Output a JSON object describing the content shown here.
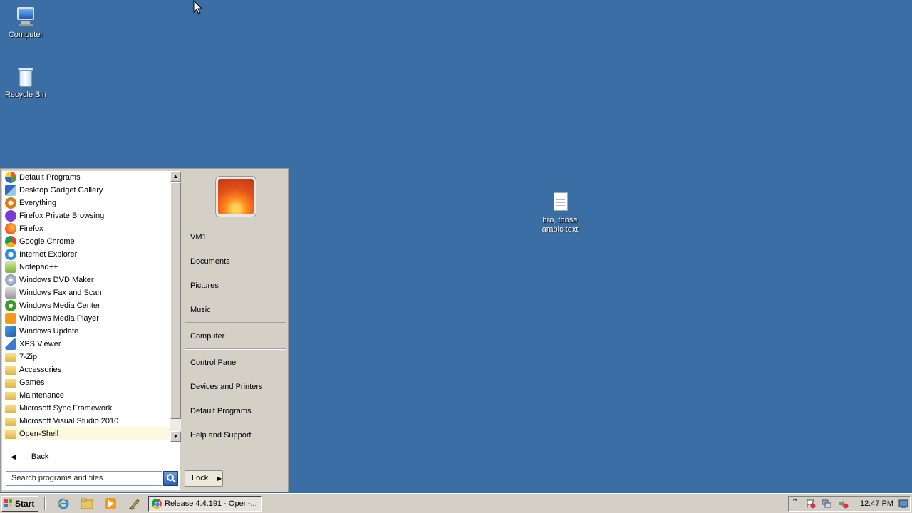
{
  "desktop": {
    "icons": [
      {
        "label": "Computer",
        "icon": "computer-icon"
      },
      {
        "label": "Recycle Bin",
        "icon": "recycle-bin-icon"
      },
      {
        "label_line1": "bro, those",
        "label_line2": "arabic text",
        "icon": "text-file-icon"
      }
    ],
    "background_color": "#3a6ea5"
  },
  "start_menu": {
    "programs": [
      {
        "label": "Default Programs",
        "icon": "default-programs-icon"
      },
      {
        "label": "Desktop Gadget Gallery",
        "icon": "gadget-gallery-icon"
      },
      {
        "label": "Everything",
        "icon": "everything-search-icon"
      },
      {
        "label": "Firefox Private Browsing",
        "icon": "firefox-private-icon"
      },
      {
        "label": "Firefox",
        "icon": "firefox-icon"
      },
      {
        "label": "Google Chrome",
        "icon": "chrome-icon"
      },
      {
        "label": "Internet Explorer",
        "icon": "internet-explorer-icon"
      },
      {
        "label": "Notepad++",
        "icon": "notepad-plus-icon"
      },
      {
        "label": "Windows DVD Maker",
        "icon": "dvd-maker-icon"
      },
      {
        "label": "Windows Fax and Scan",
        "icon": "fax-scan-icon"
      },
      {
        "label": "Windows Media Center",
        "icon": "media-center-icon"
      },
      {
        "label": "Windows Media Player",
        "icon": "media-player-icon"
      },
      {
        "label": "Windows Update",
        "icon": "windows-update-icon"
      },
      {
        "label": "XPS Viewer",
        "icon": "xps-viewer-icon"
      },
      {
        "label": "7-Zip",
        "icon": "folder-icon"
      },
      {
        "label": "Accessories",
        "icon": "folder-icon"
      },
      {
        "label": "Games",
        "icon": "folder-icon"
      },
      {
        "label": "Maintenance",
        "icon": "folder-icon"
      },
      {
        "label": "Microsoft Sync Framework",
        "icon": "folder-icon"
      },
      {
        "label": "Microsoft Visual Studio 2010",
        "icon": "folder-icon"
      },
      {
        "label": "Open-Shell",
        "icon": "folder-icon"
      }
    ],
    "back_label": "Back",
    "search_placeholder": "Search programs and files",
    "right_items": {
      "user": "VM1",
      "documents": "Documents",
      "pictures": "Pictures",
      "music": "Music",
      "computer": "Computer",
      "control_panel": "Control Panel",
      "devices": "Devices and Printers",
      "default_programs": "Default Programs",
      "help": "Help and Support"
    },
    "lock_label": "Lock"
  },
  "taskbar": {
    "start_label": "Start",
    "task_button_label": "Release 4.4.191 · Open-...",
    "clock": "12:47 PM"
  }
}
